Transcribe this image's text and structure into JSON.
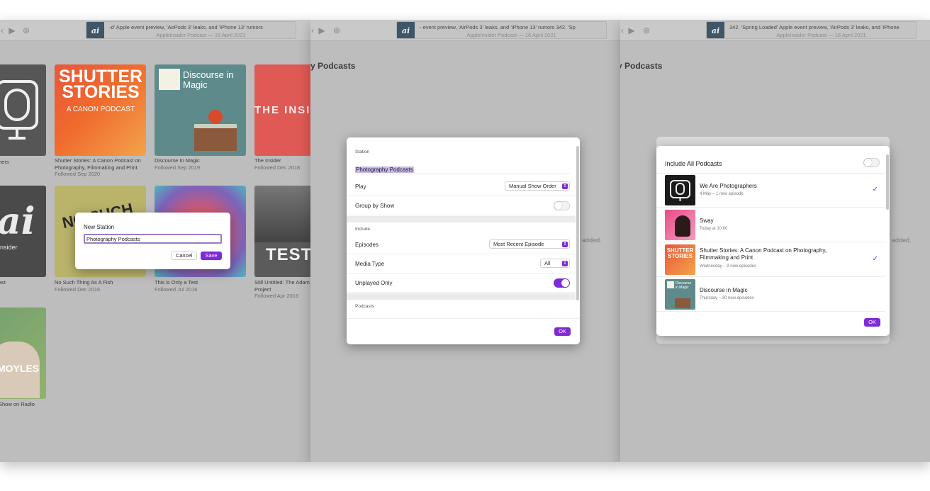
{
  "colors": {
    "accent": "#7e2ad7",
    "window_bg": "#bdbdbd",
    "dialog_bg": "#ffffff"
  },
  "toolbar": {
    "left": {
      "title": "-d' Apple event preview, 'AirPods 3' leaks, and 'iPhone 13' rumors",
      "subtitle": "AppleInsider Podcast — 16 April 2021"
    },
    "middle": {
      "title": "- event preview, 'AirPods 3' leaks, and 'iPhone 13' rumors   342. 'Sp",
      "subtitle": "AppleInsider Podcast — 16 April 2021"
    },
    "right": {
      "title": "342. 'Spring Loaded' Apple event preview, 'AirPods 3' leaks, and 'iPhone",
      "subtitle": "AppleInsider Podcast — 16 April 2021"
    },
    "art_label": "ai",
    "play_icon": "play-icon",
    "skip_icon": "skip-forward-icon"
  },
  "library": {
    "tiles": [
      {
        "art_text": "",
        "caption": "hers",
        "sub": ""
      },
      {
        "art_text": "SHUTTER STORIES",
        "art_sub": "A CANON PODCAST",
        "caption": "Shutter Stories: A Canon Podcast on Photography, Filmmaking and Print",
        "sub": "Followed Sep 2020"
      },
      {
        "art_text": "Discourse in Magic",
        "caption": "Discourse In Magic",
        "sub": "Followed Sep 2019"
      },
      {
        "art_text": "THE INSI",
        "caption": "The Insider",
        "sub": "Followed Dec 2018"
      },
      {
        "art_text": "ai",
        "art_sub": "nsider",
        "caption": "ast",
        "sub": ""
      },
      {
        "art_text": "NO SUCH",
        "caption": "No Such Thing As A Fish",
        "sub": "Followed Dec 2016"
      },
      {
        "art_text": "",
        "caption": "This is Only a Test",
        "sub": "Followed Jul 2016"
      },
      {
        "art_text": "TEST",
        "caption": "Still Untitled: The Adam Savage Project",
        "sub": "Followed Apr 2016"
      },
      {
        "art_text": "MOYLES",
        "caption": "Show on Radio",
        "sub": ""
      }
    ]
  },
  "new_station_dialog": {
    "label": "New Station",
    "input_value": "Photography Podcasts",
    "cancel_label": "Cancel",
    "save_label": "Save"
  },
  "sheet_title": "y Podcasts",
  "added_text": "added.",
  "settings_dialog": {
    "station_header": "Station",
    "station_name": "Photography Podcasts",
    "play_label": "Play",
    "play_value": "Manual Show Order",
    "group_label": "Group by Show",
    "group_on": false,
    "include_header": "Include",
    "episodes_label": "Episodes",
    "episodes_value": "Most Recent Episode",
    "media_label": "Media Type",
    "media_value": "All",
    "unplayed_label": "Unplayed Only",
    "unplayed_on": true,
    "podcasts_header": "Podcasts",
    "ok_label": "OK"
  },
  "podcasts_dialog": {
    "include_all_label": "Include All Podcasts",
    "include_all_on": false,
    "podcasts": [
      {
        "name": "We Are Photographers",
        "meta": "4 May – 1 new episode",
        "checked": true,
        "art_icon": "microphone-camera-icon"
      },
      {
        "name": "Sway",
        "meta": "Today at 10:00",
        "checked": false,
        "art_icon": "sway-portrait-icon"
      },
      {
        "name": "Shutter Stories: A Canon Podcast on Photography, Filmmaking and Print",
        "meta": "Wednesday – 9 new episodes",
        "checked": true,
        "art_icon": "shutter-stories-icon"
      },
      {
        "name": "Discourse in Magic",
        "meta": "Thursday – 30 new episodes",
        "checked": false,
        "art_icon": "discourse-in-magic-icon"
      }
    ],
    "check_glyph": "✓",
    "ok_label": "OK"
  }
}
